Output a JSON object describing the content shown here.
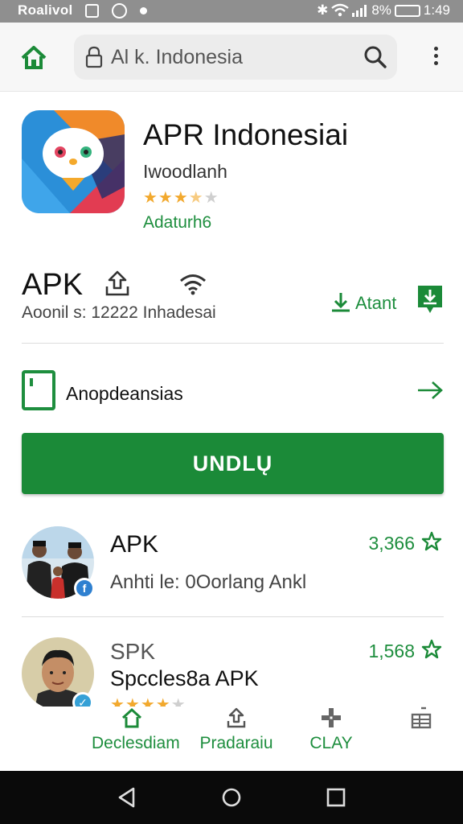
{
  "status_bar": {
    "carrier": "Roalivol",
    "battery": "8%",
    "time": "1:49"
  },
  "app_bar": {
    "search_text": "Al k. Indonesia",
    "icons": [
      "home-icon",
      "lock-icon",
      "search-icon",
      "more-vert-icon"
    ]
  },
  "app": {
    "title": "APR Indonesiai",
    "developer": "Iwoodlanh",
    "rating": 3.5,
    "tag": "Adaturh6"
  },
  "info": {
    "label": "APK",
    "sub": "Aoonil s: 12222  Inhadesai",
    "download_label": "Atant"
  },
  "link_row": {
    "label": "Anopdeansias"
  },
  "primary_button": {
    "label": "UNDLŲ"
  },
  "list": [
    {
      "title": "APK",
      "sub": "Anhti le: 0Oorlang Ankl",
      "count": "3,366"
    },
    {
      "title": "SPK",
      "sub": "Spccles8a APK",
      "count": "1,568",
      "rating": 4
    }
  ],
  "bottom_nav": [
    {
      "label": "Declesdiam",
      "icon": "home-icon"
    },
    {
      "label": "Pradaraiu",
      "icon": "upload-icon"
    },
    {
      "label": "CLAY",
      "icon": "game-icon"
    },
    {
      "label": "",
      "icon": "library-icon"
    }
  ],
  "colors": {
    "accent": "#1b8a38",
    "star": "#f2a92e",
    "status_bar": "#8f8f8f"
  }
}
